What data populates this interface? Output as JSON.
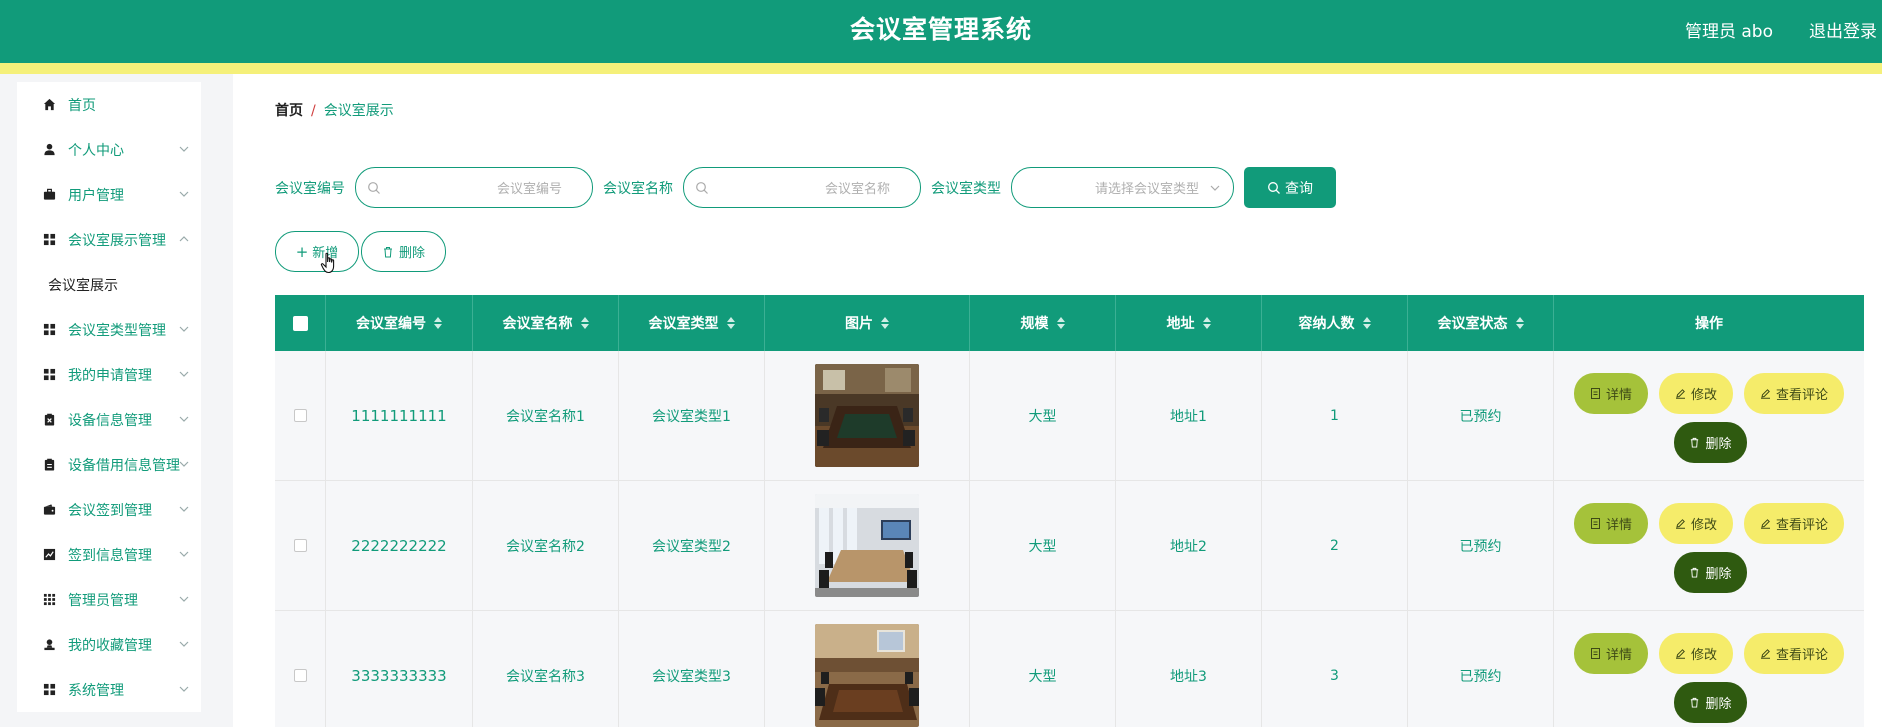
{
  "header": {
    "title": "会议室管理系统",
    "user": "管理员 abo",
    "logout": "退出登录"
  },
  "sidebar": {
    "items": [
      {
        "label": "首页",
        "icon": "home-icon",
        "has_children": false
      },
      {
        "label": "个人中心",
        "icon": "user-icon",
        "has_children": true
      },
      {
        "label": "用户管理",
        "icon": "briefcase-icon",
        "has_children": true
      },
      {
        "label": "会议室展示管理",
        "icon": "grid-icon",
        "has_children": true,
        "expanded": true
      },
      {
        "label": "会议室类型管理",
        "icon": "grid-icon",
        "has_children": true
      },
      {
        "label": "我的申请管理",
        "icon": "grid-icon",
        "has_children": true
      },
      {
        "label": "设备信息管理",
        "icon": "clipboard-x-icon",
        "has_children": true
      },
      {
        "label": "设备借用信息管理",
        "icon": "clipboard-icon",
        "has_children": true
      },
      {
        "label": "会议签到管理",
        "icon": "wallet-icon",
        "has_children": true
      },
      {
        "label": "签到信息管理",
        "icon": "chart-icon",
        "has_children": true
      },
      {
        "label": "管理员管理",
        "icon": "apps-icon",
        "has_children": true
      },
      {
        "label": "我的收藏管理",
        "icon": "person-icon",
        "has_children": true
      },
      {
        "label": "系统管理",
        "icon": "grid-icon",
        "has_children": true
      }
    ],
    "submenu": {
      "label": "会议室展示"
    }
  },
  "breadcrumb": {
    "home": "首页",
    "separator": "/",
    "current": "会议室展示"
  },
  "search": {
    "code_label": "会议室编号",
    "code_placeholder": "会议室编号",
    "name_label": "会议室名称",
    "name_placeholder": "会议室名称",
    "type_label": "会议室类型",
    "type_placeholder": "请选择会议室类型",
    "query_label": "查询"
  },
  "actions": {
    "add_label": "新增",
    "delete_label": "删除"
  },
  "table": {
    "columns": [
      "会议室编号",
      "会议室名称",
      "会议室类型",
      "图片",
      "规模",
      "地址",
      "容纳人数",
      "会议室状态",
      "操作"
    ],
    "rows": [
      {
        "code": "1111111111",
        "name": "会议室名称1",
        "type": "会议室类型1",
        "scale": "大型",
        "address": "地址1",
        "capacity": "1",
        "status": "已预约"
      },
      {
        "code": "2222222222",
        "name": "会议室名称2",
        "type": "会议室类型2",
        "scale": "大型",
        "address": "地址2",
        "capacity": "2",
        "status": "已预约"
      },
      {
        "code": "3333333333",
        "name": "会议室名称3",
        "type": "会议室类型3",
        "scale": "大型",
        "address": "地址3",
        "capacity": "3",
        "status": "已预约"
      }
    ],
    "row_actions": {
      "detail": "详情",
      "edit": "修改",
      "review": "查看评论",
      "delete": "删除"
    }
  },
  "colors": {
    "primary": "#119b7a",
    "accent_strip": "#f5f07a",
    "detail_button": "#a5c23a",
    "edit_button": "#f5ec6a",
    "delete_button": "#2f5a10"
  }
}
